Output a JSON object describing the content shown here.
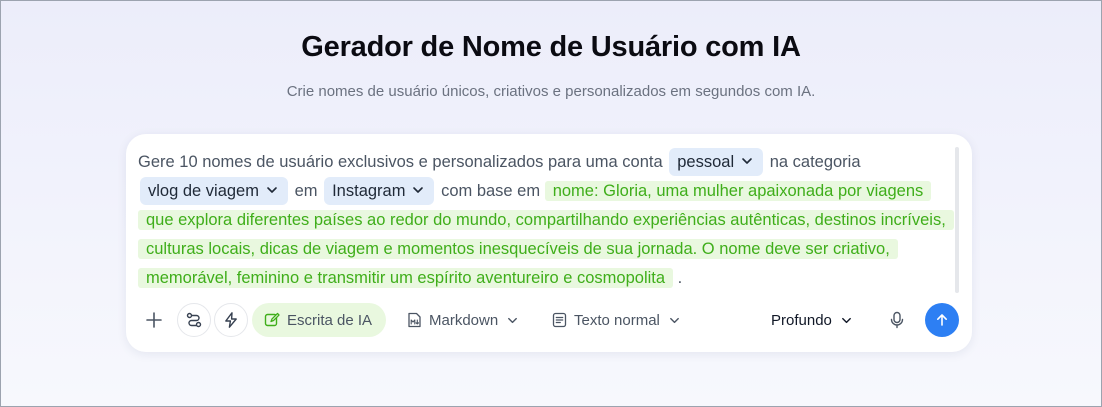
{
  "header": {
    "title": "Gerador de Nome de Usuário com IA",
    "subtitle": "Crie nomes de usuário únicos, criativos e personalizados em segundos com IA."
  },
  "prompt": {
    "text_1": "Gere 10 nomes de usuário exclusivos e personalizados para uma conta",
    "account_type": "pessoal",
    "text_2": "na categoria",
    "category": "vlog de viagem",
    "text_3": "em",
    "platform": "Instagram",
    "text_4": "com base em",
    "description": "nome: Gloria, uma mulher apaixonada por viagens que explora diferentes países ao redor do mundo, compartilhando experiências autênticas, destinos incríveis, culturas locais, dicas de viagem e momentos inesquecíveis de sua jornada. O nome deve ser criativo, memorável, feminino e transmitir um espírito aventureiro e cosmopolita",
    "text_end": "."
  },
  "toolbar": {
    "ai_writing_label": "Escrita de IA",
    "format_label": "Markdown",
    "style_label": "Texto normal",
    "mode_label": "Profundo"
  },
  "colors": {
    "accent": "#2d7ff3",
    "chip_bg": "#e2ecfa",
    "highlight_bg": "#e9f8df",
    "highlight_text": "#3fae1a"
  },
  "icons": {
    "add": "plus-icon",
    "route": "route-icon",
    "lightning": "lightning-icon",
    "edit": "edit-icon",
    "markdown": "markdown-file-icon",
    "text": "text-document-icon",
    "mic": "microphone-icon",
    "send": "arrow-up-icon"
  }
}
